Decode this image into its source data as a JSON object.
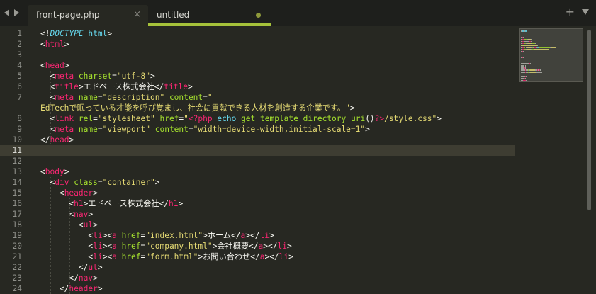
{
  "tabs": [
    {
      "label": "front-page.php",
      "active": true,
      "close_glyph": "×"
    },
    {
      "label": "untitled",
      "active": false,
      "dirty": true
    }
  ],
  "tab_actions": {
    "new_tab_glyph": "+"
  },
  "editor": {
    "current_line": 11,
    "line_numbers": [
      "1",
      "2",
      "3",
      "4",
      "5",
      "6",
      "7",
      "",
      "8",
      "9",
      "10",
      "11",
      "12",
      "13",
      "14",
      "15",
      "16",
      "17",
      "18",
      "19",
      "20",
      "21",
      "22",
      "23",
      "24"
    ]
  },
  "colors": {
    "background": "#272822",
    "tag": "#f92672",
    "attribute": "#a6e22e",
    "string": "#e6db74",
    "keyword": "#66d9ef",
    "active_tab_underline": "#a6c23a"
  },
  "code_lines": [
    [
      {
        "c": "p",
        "t": "<!"
      },
      {
        "c": "d",
        "t": "DOCTYPE"
      },
      {
        "c": "p",
        "t": " "
      },
      {
        "c": "k",
        "t": "html"
      },
      {
        "c": "p",
        "t": ">"
      }
    ],
    [
      {
        "c": "p",
        "t": "<"
      },
      {
        "c": "t",
        "t": "html"
      },
      {
        "c": "p",
        "t": ">"
      }
    ],
    [],
    [
      {
        "c": "p",
        "t": "<"
      },
      {
        "c": "t",
        "t": "head"
      },
      {
        "c": "p",
        "t": ">"
      }
    ],
    [
      {
        "c": "p",
        "t": "  <"
      },
      {
        "c": "t",
        "t": "meta"
      },
      {
        "c": "p",
        "t": " "
      },
      {
        "c": "a",
        "t": "charset"
      },
      {
        "c": "p",
        "t": "="
      },
      {
        "c": "s",
        "t": "\"utf-8\""
      },
      {
        "c": "p",
        "t": ">"
      }
    ],
    [
      {
        "c": "p",
        "t": "  <"
      },
      {
        "c": "t",
        "t": "title"
      },
      {
        "c": "p",
        "t": ">エドベース株式会社</"
      },
      {
        "c": "t",
        "t": "title"
      },
      {
        "c": "p",
        "t": ">"
      }
    ],
    [
      {
        "c": "p",
        "t": "  <"
      },
      {
        "c": "t",
        "t": "meta"
      },
      {
        "c": "p",
        "t": " "
      },
      {
        "c": "a",
        "t": "name"
      },
      {
        "c": "p",
        "t": "="
      },
      {
        "c": "s",
        "t": "\"description\""
      },
      {
        "c": "p",
        "t": " "
      },
      {
        "c": "a",
        "t": "content"
      },
      {
        "c": "p",
        "t": "="
      },
      {
        "c": "s",
        "t": "\""
      }
    ],
    [
      {
        "c": "s",
        "t": "EdTechで眠っている才能を呼び覚まし、社会に貢献できる人材を創造する企業です。\""
      },
      {
        "c": "p",
        "t": ">"
      }
    ],
    [
      {
        "c": "p",
        "t": "  <"
      },
      {
        "c": "t",
        "t": "link"
      },
      {
        "c": "p",
        "t": " "
      },
      {
        "c": "a",
        "t": "rel"
      },
      {
        "c": "p",
        "t": "="
      },
      {
        "c": "s",
        "t": "\"stylesheet\""
      },
      {
        "c": "p",
        "t": " "
      },
      {
        "c": "a",
        "t": "href"
      },
      {
        "c": "p",
        "t": "="
      },
      {
        "c": "s",
        "t": "\""
      },
      {
        "c": "t",
        "t": "<?php"
      },
      {
        "c": "p",
        "t": " "
      },
      {
        "c": "k",
        "t": "echo"
      },
      {
        "c": "p",
        "t": " "
      },
      {
        "c": "f",
        "t": "get_template_directory_uri"
      },
      {
        "c": "p",
        "t": "()"
      },
      {
        "c": "t",
        "t": "?>"
      },
      {
        "c": "s",
        "t": "/style.css\""
      },
      {
        "c": "p",
        "t": ">"
      }
    ],
    [
      {
        "c": "p",
        "t": "  <"
      },
      {
        "c": "t",
        "t": "meta"
      },
      {
        "c": "p",
        "t": " "
      },
      {
        "c": "a",
        "t": "name"
      },
      {
        "c": "p",
        "t": "="
      },
      {
        "c": "s",
        "t": "\"viewport\""
      },
      {
        "c": "p",
        "t": " "
      },
      {
        "c": "a",
        "t": "content"
      },
      {
        "c": "p",
        "t": "="
      },
      {
        "c": "s",
        "t": "\"width=device-width,initial-scale=1\""
      },
      {
        "c": "p",
        "t": ">"
      }
    ],
    [
      {
        "c": "p",
        "t": "</"
      },
      {
        "c": "t",
        "t": "head"
      },
      {
        "c": "p",
        "t": ">"
      }
    ],
    [],
    [],
    [
      {
        "c": "p",
        "t": "<"
      },
      {
        "c": "t",
        "t": "body"
      },
      {
        "c": "p",
        "t": ">"
      }
    ],
    [
      {
        "c": "p",
        "t": "  <"
      },
      {
        "c": "t",
        "t": "div"
      },
      {
        "c": "p",
        "t": " "
      },
      {
        "c": "a",
        "t": "class"
      },
      {
        "c": "p",
        "t": "="
      },
      {
        "c": "s",
        "t": "\"container\""
      },
      {
        "c": "p",
        "t": ">"
      }
    ],
    [
      {
        "c": "p",
        "t": "    <"
      },
      {
        "c": "t",
        "t": "header"
      },
      {
        "c": "p",
        "t": ">"
      }
    ],
    [
      {
        "c": "p",
        "t": "      <"
      },
      {
        "c": "t",
        "t": "h1"
      },
      {
        "c": "p",
        "t": ">エドベース株式会社</"
      },
      {
        "c": "t",
        "t": "h1"
      },
      {
        "c": "p",
        "t": ">"
      }
    ],
    [
      {
        "c": "p",
        "t": "      <"
      },
      {
        "c": "t",
        "t": "nav"
      },
      {
        "c": "p",
        "t": ">"
      }
    ],
    [
      {
        "c": "p",
        "t": "        <"
      },
      {
        "c": "t",
        "t": "ul"
      },
      {
        "c": "p",
        "t": ">"
      }
    ],
    [
      {
        "c": "p",
        "t": "          <"
      },
      {
        "c": "t",
        "t": "li"
      },
      {
        "c": "p",
        "t": "><"
      },
      {
        "c": "t",
        "t": "a"
      },
      {
        "c": "p",
        "t": " "
      },
      {
        "c": "a",
        "t": "href"
      },
      {
        "c": "p",
        "t": "="
      },
      {
        "c": "s",
        "t": "\"index.html\""
      },
      {
        "c": "p",
        "t": ">ホーム</"
      },
      {
        "c": "t",
        "t": "a"
      },
      {
        "c": "p",
        "t": "></"
      },
      {
        "c": "t",
        "t": "li"
      },
      {
        "c": "p",
        "t": ">"
      }
    ],
    [
      {
        "c": "p",
        "t": "          <"
      },
      {
        "c": "t",
        "t": "li"
      },
      {
        "c": "p",
        "t": "><"
      },
      {
        "c": "t",
        "t": "a"
      },
      {
        "c": "p",
        "t": " "
      },
      {
        "c": "a",
        "t": "href"
      },
      {
        "c": "p",
        "t": "="
      },
      {
        "c": "s",
        "t": "\"company.html\""
      },
      {
        "c": "p",
        "t": ">会社概要</"
      },
      {
        "c": "t",
        "t": "a"
      },
      {
        "c": "p",
        "t": "></"
      },
      {
        "c": "t",
        "t": "li"
      },
      {
        "c": "p",
        "t": ">"
      }
    ],
    [
      {
        "c": "p",
        "t": "          <"
      },
      {
        "c": "t",
        "t": "li"
      },
      {
        "c": "p",
        "t": "><"
      },
      {
        "c": "t",
        "t": "a"
      },
      {
        "c": "p",
        "t": " "
      },
      {
        "c": "a",
        "t": "href"
      },
      {
        "c": "p",
        "t": "="
      },
      {
        "c": "s",
        "t": "\"form.html\""
      },
      {
        "c": "p",
        "t": ">お問い合わせ</"
      },
      {
        "c": "t",
        "t": "a"
      },
      {
        "c": "p",
        "t": "></"
      },
      {
        "c": "t",
        "t": "li"
      },
      {
        "c": "p",
        "t": ">"
      }
    ],
    [
      {
        "c": "p",
        "t": "        </"
      },
      {
        "c": "t",
        "t": "ul"
      },
      {
        "c": "p",
        "t": ">"
      }
    ],
    [
      {
        "c": "p",
        "t": "      </"
      },
      {
        "c": "t",
        "t": "nav"
      },
      {
        "c": "p",
        "t": ">"
      }
    ],
    [
      {
        "c": "p",
        "t": "    </"
      },
      {
        "c": "t",
        "t": "header"
      },
      {
        "c": "p",
        "t": ">"
      }
    ],
    []
  ]
}
